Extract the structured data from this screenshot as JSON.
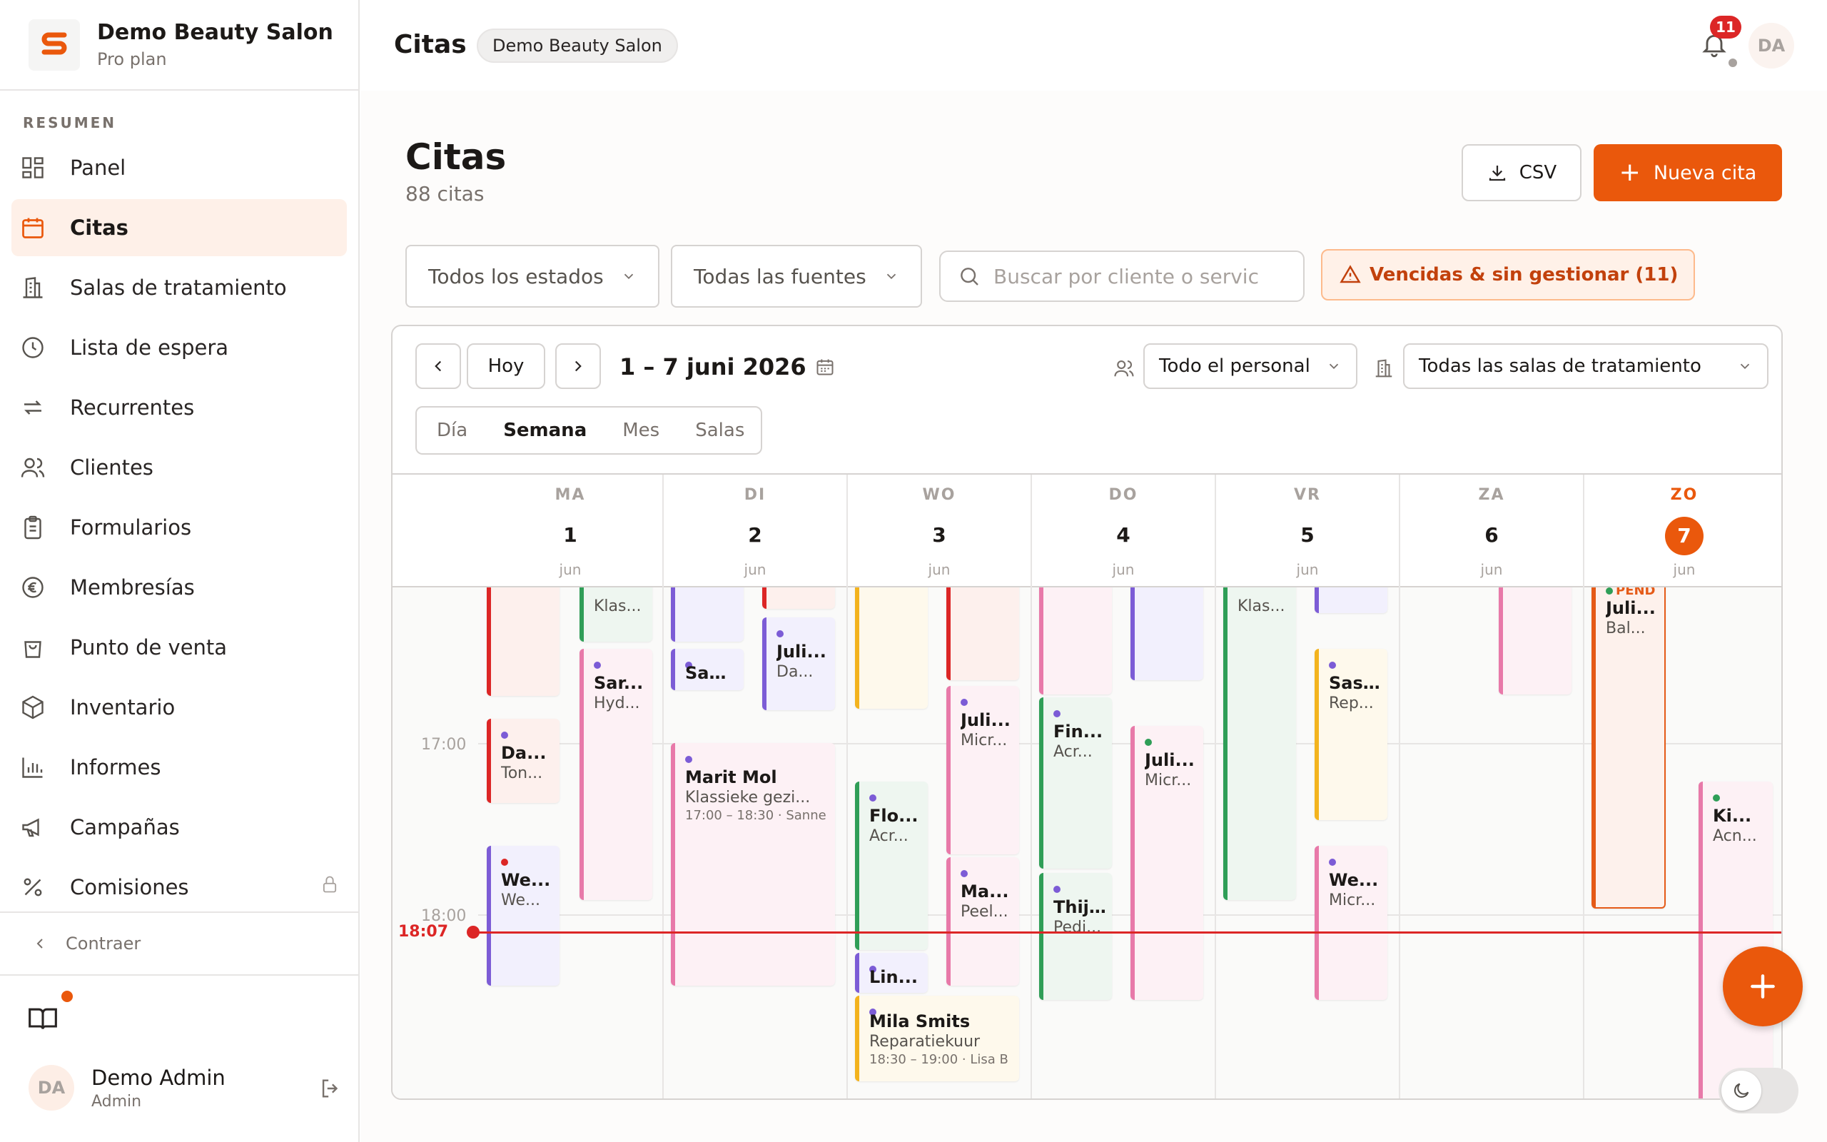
{
  "brand": {
    "name": "Demo Beauty Salon",
    "plan": "Pro plan",
    "accent": "#ea580c"
  },
  "sidebar": {
    "section": "RESUMEN",
    "items": [
      {
        "label": "Panel",
        "icon": "dashboard-icon"
      },
      {
        "label": "Citas",
        "icon": "calendar-icon",
        "active": true
      },
      {
        "label": "Salas de tratamiento",
        "icon": "building-icon"
      },
      {
        "label": "Lista de espera",
        "icon": "clock-icon"
      },
      {
        "label": "Recurrentes",
        "icon": "repeat-icon"
      },
      {
        "label": "Clientes",
        "icon": "users-icon"
      },
      {
        "label": "Formularios",
        "icon": "clipboard-icon"
      },
      {
        "label": "Membresías",
        "icon": "euro-icon"
      },
      {
        "label": "Punto de venta",
        "icon": "shopping-bag-icon"
      },
      {
        "label": "Inventario",
        "icon": "package-icon"
      },
      {
        "label": "Informes",
        "icon": "bar-chart-icon"
      },
      {
        "label": "Campañas",
        "icon": "megaphone-icon"
      },
      {
        "label": "Comisiones",
        "icon": "percent-icon",
        "locked": true
      }
    ],
    "collapse": "Contraer",
    "user": {
      "initials": "DA",
      "name": "Demo Admin",
      "role": "Admin"
    }
  },
  "topbar": {
    "title": "Citas",
    "badge": "Demo Beauty Salon",
    "notifications": "11",
    "initials": "DA"
  },
  "header": {
    "title": "Citas",
    "count": "88 citas",
    "csv": "CSV",
    "new": "Nueva cita"
  },
  "filters": {
    "status": "Todos los estados",
    "source": "Todas las fuentes",
    "search_placeholder": "Buscar por cliente o servic",
    "overdue": "Vencidas & sin gestionar (11)"
  },
  "calendar": {
    "today": "Hoy",
    "range": "1 – 7 juni 2026",
    "staff": "Todo el personal",
    "rooms": "Todas las salas de tratamiento",
    "views": [
      "Día",
      "Semana",
      "Mes",
      "Salas"
    ],
    "days": [
      {
        "name": "MA",
        "num": "1",
        "month": "jun"
      },
      {
        "name": "DI",
        "num": "2",
        "month": "jun"
      },
      {
        "name": "WO",
        "num": "3",
        "month": "jun"
      },
      {
        "name": "DO",
        "num": "4",
        "month": "jun"
      },
      {
        "name": "VR",
        "num": "5",
        "month": "jun"
      },
      {
        "name": "ZA",
        "num": "6",
        "month": "jun"
      },
      {
        "name": "ZO",
        "num": "7",
        "month": "jun"
      }
    ],
    "times": [
      "17:00",
      "18:00"
    ],
    "now": "18:07",
    "events": {
      "e1": {
        "t": "Da...",
        "s": "Ton..."
      },
      "e2": {
        "t": "We...",
        "s": "We..."
      },
      "e3": {
        "t": "Klas..."
      },
      "e4": {
        "t": "Sar...",
        "s": "Hyd..."
      },
      "e5": {
        "t": "San..."
      },
      "e6": {
        "t": "Juli...",
        "s": "Da..."
      },
      "e7": {
        "t": "Marit Mol",
        "s": "Klassieke gezi...",
        "x": "17:00 – 18:30 · Sanne"
      },
      "e8": {
        "t": "Flo...",
        "s": "Acr..."
      },
      "e9": {
        "t": "Lin..."
      },
      "e10": {
        "t": "Mila Smits",
        "s": "Reparatiekuur",
        "x": "18:30 – 19:00 · Lisa B"
      },
      "e11": {
        "t": "Juli...",
        "s": "Micr..."
      },
      "e12": {
        "t": "Ma...",
        "s": "Peel..."
      },
      "e13": {
        "t": "Fin...",
        "s": "Acr..."
      },
      "e14": {
        "t": "Thij...",
        "s": "Pedi..."
      },
      "e15": {
        "t": "Juli...",
        "s": "Micr..."
      },
      "e16": {
        "t": "Klas..."
      },
      "e17": {
        "t": "Sas...",
        "s": "Rep..."
      },
      "e18": {
        "t": "We...",
        "s": "Micr..."
      },
      "e19": {
        "t": "Juli...",
        "s": "Bal...",
        "x": "PEND"
      },
      "e20": {
        "t": "Ki...",
        "s": "Acn..."
      }
    }
  }
}
